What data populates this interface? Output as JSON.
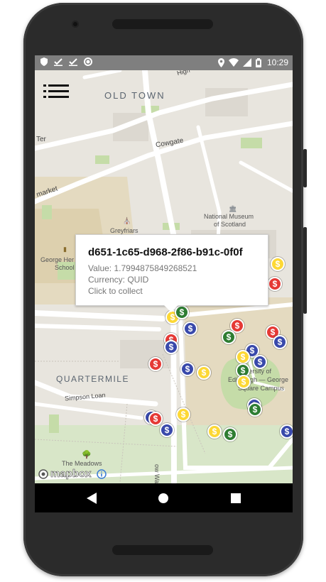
{
  "status_bar": {
    "left_icons": [
      "shield-icon",
      "check-download-icon",
      "check-download-icon",
      "circle-icon"
    ],
    "right_icons": [
      "location-pin-icon",
      "wifi-icon",
      "signal-icon",
      "battery-icon"
    ],
    "time": "10:29"
  },
  "map": {
    "labels": {
      "old_town": "OLD TOWN",
      "cowgate": "Cowgate",
      "ter": "Ter",
      "grassmarket": "market",
      "museum_line1": "National Museum",
      "museum_line2": "of Scotland",
      "greyfriars": "Greyfriars",
      "george_heriots_1": "George Her",
      "george_heriots_2": "School",
      "quartermile": "QUARTERMILE",
      "simpson_loan": "Simpson Loan",
      "university_1": "iversity of",
      "university_2": "Edinburgh — George",
      "university_3": "Square Campus",
      "meadows": "The Meadows",
      "meadow_walk": "ow Walk",
      "high_st": "High"
    },
    "attribution": "mapbox",
    "coin_symbol": "$",
    "coin_colors": {
      "red": "#e53935",
      "blue": "#3949ab",
      "green": "#2e7d32",
      "yellow": "#fdd835"
    }
  },
  "popup": {
    "title": "d651-1c65-d968-2f86-b91c-0f0f",
    "value": "Value: 1.7994875849268521",
    "currency": "Currency: QUID",
    "action": "Click to collect"
  },
  "nav": {
    "back": "back-triangle-icon",
    "home": "home-circle-icon",
    "recents": "recents-square-icon"
  }
}
